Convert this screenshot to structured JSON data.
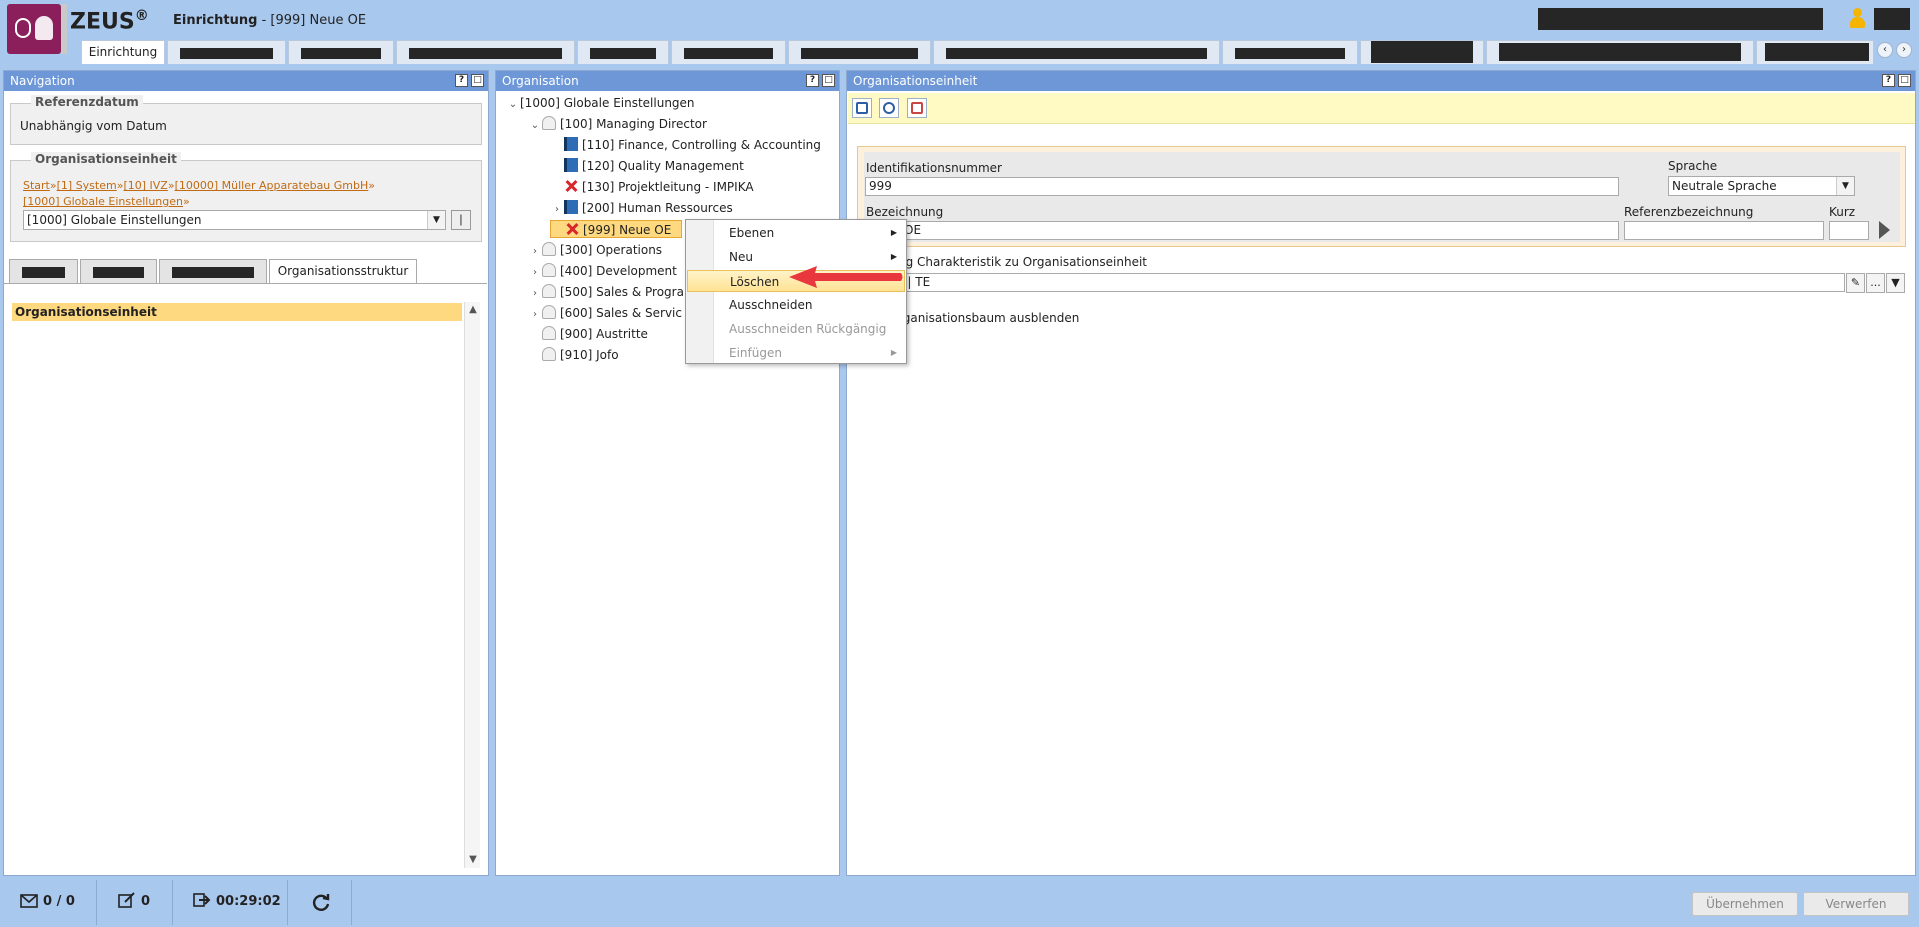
{
  "app": {
    "brand": "ZEUS",
    "brand_mark": "®",
    "title_bold": "Einrichtung",
    "title_rest": " - [999] Neue OE"
  },
  "top_tabs": {
    "active_label": "Einrichtung"
  },
  "navigation": {
    "panel_title": "Navigation",
    "help": "?",
    "referenzdatum_legend": "Referenzdatum",
    "referenzdatum_value": "Unabhängig vom Datum",
    "oe_legend": "Organisationseinheit",
    "breadcrumb": [
      "Start",
      "[1] System",
      "[10] IVZ",
      "[10000] Müller Apparatebau GmbH",
      "[1000] Globale Einstellungen"
    ],
    "breadcrumb_sep": "»",
    "selected_oe": "[1000] Globale Einstellungen",
    "tab_active": "Organisationsstruktur",
    "list_header": "Organisationseinheit"
  },
  "organisation": {
    "panel_title": "Organisation",
    "help": "?",
    "tree": [
      {
        "label": "[1000] Globale Einstellungen",
        "icon": "none",
        "twisty": "v",
        "level": 0
      },
      {
        "label": "[100] Managing Director",
        "icon": "people",
        "twisty": "v",
        "level": 1
      },
      {
        "label": "[110] Finance, Controlling & Accounting",
        "icon": "book",
        "twisty": "",
        "level": 2
      },
      {
        "label": "[120] Quality Management",
        "icon": "book",
        "twisty": "",
        "level": 2
      },
      {
        "label": "[130] Projektleitung - IMPIKA",
        "icon": "x",
        "twisty": "",
        "level": 2
      },
      {
        "label": "[200] Human Ressources",
        "icon": "book",
        "twisty": ">",
        "level": 2
      },
      {
        "label": "[999] Neue OE",
        "icon": "x",
        "twisty": "",
        "level": 2,
        "selected": true
      },
      {
        "label": "[300] Operations",
        "icon": "people",
        "twisty": ">",
        "level": 1
      },
      {
        "label": "[400] Development",
        "icon": "people",
        "twisty": ">",
        "level": 1
      },
      {
        "label": "[500] Sales & Progra",
        "icon": "people",
        "twisty": ">",
        "level": 1
      },
      {
        "label": "[600] Sales & Servic",
        "icon": "people",
        "twisty": ">",
        "level": 1
      },
      {
        "label": "[900] Austritte",
        "icon": "people",
        "twisty": "",
        "level": 1
      },
      {
        "label": "[910] Jofo",
        "icon": "people",
        "twisty": "",
        "level": 1
      }
    ]
  },
  "context_menu": {
    "items": [
      {
        "label": "Ebenen",
        "submenu": true,
        "disabled": false
      },
      {
        "label": "Neu",
        "submenu": true,
        "disabled": false
      },
      {
        "label": "Löschen",
        "submenu": false,
        "disabled": false,
        "highlighted": true
      },
      {
        "label": "Ausschneiden",
        "submenu": false,
        "disabled": false
      },
      {
        "label": "Ausschneiden Rückgängig",
        "submenu": false,
        "disabled": true
      },
      {
        "label": "Einfügen",
        "submenu": true,
        "disabled": true
      }
    ],
    "arrow_color": "#e8383d"
  },
  "detail": {
    "panel_title": "Organisationseinheit",
    "help": "?",
    "id_label": "Identifikationsnummer",
    "id_value": "999",
    "sprache_label": "Sprache",
    "sprache_value": "Neutrale Sprache",
    "bezeichnung_label": "Bezeichnung",
    "bezeichnung_value": "OE",
    "referenz_label": "Referenzbezeichnung",
    "referenz_value": "",
    "kurz_label": "Kurz",
    "kurz_value": "",
    "charakteristik_label": "ng Charakteristik zu Organisationseinheit",
    "charakteristik_value": "n | TE",
    "lookup_more": "...",
    "baum_label": "rganisationsbaum ausblenden"
  },
  "footer": {
    "messages": "0 / 0",
    "edits": "0",
    "session_time": "00:29:02",
    "apply_label": "Übernehmen",
    "discard_label": "Verwerfen"
  },
  "colors": {
    "accent": "#6d97d6",
    "background": "#a9c8ee",
    "selection": "#ffd97f",
    "brand": "#8b1f5b"
  }
}
